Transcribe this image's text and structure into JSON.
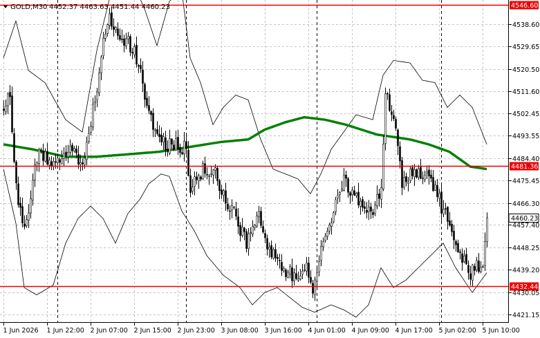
{
  "header": {
    "symbol_label": "GOLD,M30",
    "ohlc_text": "4452.37 4463.63 4451.44 4460.23"
  },
  "chart_data": {
    "type": "candlestick",
    "symbol": "GOLD",
    "timeframe": "M30",
    "ylim": [
      4418.0,
      4548.5
    ],
    "y_ticks": [
      4421.15,
      4430.05,
      4439.2,
      4448.25,
      4457.4,
      4466.3,
      4475.45,
      4484.4,
      4493.55,
      4502.45,
      4511.6,
      4520.5,
      4529.65,
      4538.6
    ],
    "x_ticks": [
      "1 Jun 2026",
      "1 Jun 22:00",
      "2 Jun 07:00",
      "2 Jun 15:00",
      "2 Jun 23:00",
      "3 Jun 08:00",
      "3 Jun 16:00",
      "4 Jun 01:00",
      "4 Jun 09:00",
      "4 Jun 17:00",
      "5 Jun 02:00",
      "5 Jun 10:00"
    ],
    "candle_count": 234,
    "bar_step": 3,
    "period_separators": [
      26,
      88,
      151,
      211
    ],
    "vertical_grid_every": 21,
    "grid": true,
    "horizontal_levels": [
      {
        "value": 4546.6,
        "label": "4546.60",
        "color": "#ee0000"
      },
      {
        "value": 4481.36,
        "label": "4481.36",
        "color": "#ee0000"
      },
      {
        "value": 4432.44,
        "label": "4432.44",
        "color": "#ee0000"
      }
    ],
    "current_price": {
      "value": 4460.23,
      "label": "4460.23"
    },
    "moving_average_color": "#008000",
    "band_color": "#000000",
    "candle_color": "#000000",
    "candle_up_fill": "#ffffff",
    "price_path": [
      [
        0,
        4505
      ],
      [
        3,
        4510
      ],
      [
        5,
        4485
      ],
      [
        7,
        4465
      ],
      [
        10,
        4455
      ],
      [
        13,
        4470
      ],
      [
        17,
        4488
      ],
      [
        22,
        4482
      ],
      [
        28,
        4486
      ],
      [
        33,
        4490
      ],
      [
        38,
        4480
      ],
      [
        42,
        4500
      ],
      [
        45,
        4512
      ],
      [
        48,
        4535
      ],
      [
        51,
        4540
      ],
      [
        55,
        4533
      ],
      [
        60,
        4531
      ],
      [
        65,
        4524
      ],
      [
        68,
        4507
      ],
      [
        71,
        4500
      ],
      [
        74,
        4492
      ],
      [
        78,
        4490
      ],
      [
        84,
        4490
      ],
      [
        88,
        4488
      ],
      [
        90,
        4472
      ],
      [
        94,
        4478
      ],
      [
        97,
        4480
      ],
      [
        102,
        4478
      ],
      [
        106,
        4470
      ],
      [
        112,
        4460
      ],
      [
        117,
        4450
      ],
      [
        123,
        4460
      ],
      [
        128,
        4448
      ],
      [
        133,
        4440
      ],
      [
        138,
        4438
      ],
      [
        143,
        4436
      ],
      [
        146,
        4442
      ],
      [
        149,
        4432
      ],
      [
        152,
        4443
      ],
      [
        156,
        4455
      ],
      [
        160,
        4465
      ],
      [
        164,
        4476
      ],
      [
        168,
        4471
      ],
      [
        172,
        4464
      ],
      [
        176,
        4462
      ],
      [
        180,
        4467
      ],
      [
        182,
        4472
      ],
      [
        184,
        4510
      ],
      [
        186,
        4506
      ],
      [
        188,
        4500
      ],
      [
        190,
        4488
      ],
      [
        192,
        4474
      ],
      [
        196,
        4478
      ],
      [
        200,
        4479
      ],
      [
        205,
        4477
      ],
      [
        208,
        4472
      ],
      [
        211,
        4465
      ],
      [
        214,
        4460
      ],
      [
        218,
        4450
      ],
      [
        221,
        4445
      ],
      [
        224,
        4437
      ],
      [
        228,
        4442
      ],
      [
        231,
        4440
      ],
      [
        233,
        4460.23
      ]
    ],
    "ma_path": [
      [
        0,
        4490
      ],
      [
        14,
        4488
      ],
      [
        30,
        4485
      ],
      [
        45,
        4485
      ],
      [
        60,
        4486
      ],
      [
        75,
        4487
      ],
      [
        90,
        4489
      ],
      [
        105,
        4491
      ],
      [
        118,
        4492
      ],
      [
        126,
        4496
      ],
      [
        136,
        4499
      ],
      [
        145,
        4501
      ],
      [
        155,
        4500
      ],
      [
        165,
        4498
      ],
      [
        180,
        4494
      ],
      [
        196,
        4492
      ],
      [
        205,
        4490
      ],
      [
        215,
        4487
      ],
      [
        225,
        4481
      ],
      [
        233,
        4480
      ]
    ],
    "band_upper_path": [
      [
        0,
        4525
      ],
      [
        6,
        4540
      ],
      [
        12,
        4520
      ],
      [
        20,
        4515
      ],
      [
        30,
        4500
      ],
      [
        38,
        4495
      ],
      [
        45,
        4528
      ],
      [
        52,
        4552
      ],
      [
        60,
        4560
      ],
      [
        68,
        4545
      ],
      [
        74,
        4530
      ],
      [
        80,
        4548
      ],
      [
        86,
        4552
      ],
      [
        90,
        4525
      ],
      [
        95,
        4515
      ],
      [
        101,
        4498
      ],
      [
        106,
        4505
      ],
      [
        112,
        4510
      ],
      [
        118,
        4508
      ],
      [
        124,
        4492
      ],
      [
        130,
        4480
      ],
      [
        136,
        4478
      ],
      [
        142,
        4476
      ],
      [
        148,
        4470
      ],
      [
        153,
        4478
      ],
      [
        158,
        4488
      ],
      [
        164,
        4495
      ],
      [
        170,
        4502
      ],
      [
        178,
        4500
      ],
      [
        183,
        4518
      ],
      [
        188,
        4524
      ],
      [
        196,
        4523
      ],
      [
        202,
        4516
      ],
      [
        208,
        4515
      ],
      [
        214,
        4505
      ],
      [
        220,
        4510
      ],
      [
        226,
        4505
      ],
      [
        233,
        4490
      ]
    ],
    "band_lower_path": [
      [
        0,
        4480
      ],
      [
        6,
        4458
      ],
      [
        10,
        4432
      ],
      [
        16,
        4429
      ],
      [
        24,
        4433
      ],
      [
        30,
        4450
      ],
      [
        36,
        4460
      ],
      [
        42,
        4465
      ],
      [
        48,
        4460
      ],
      [
        54,
        4450
      ],
      [
        60,
        4462
      ],
      [
        66,
        4468
      ],
      [
        70,
        4474
      ],
      [
        76,
        4478
      ],
      [
        80,
        4477
      ],
      [
        86,
        4463
      ],
      [
        92,
        4455
      ],
      [
        98,
        4445
      ],
      [
        106,
        4437
      ],
      [
        114,
        4432
      ],
      [
        120,
        4425
      ],
      [
        126,
        4430
      ],
      [
        132,
        4432
      ],
      [
        138,
        4428
      ],
      [
        144,
        4424
      ],
      [
        150,
        4422
      ],
      [
        158,
        4425
      ],
      [
        164,
        4423
      ],
      [
        170,
        4420
      ],
      [
        176,
        4425
      ],
      [
        182,
        4440
      ],
      [
        188,
        4432
      ],
      [
        194,
        4435
      ],
      [
        200,
        4440
      ],
      [
        206,
        4445
      ],
      [
        212,
        4450
      ],
      [
        218,
        4440
      ],
      [
        226,
        4430
      ],
      [
        233,
        4438
      ]
    ]
  }
}
